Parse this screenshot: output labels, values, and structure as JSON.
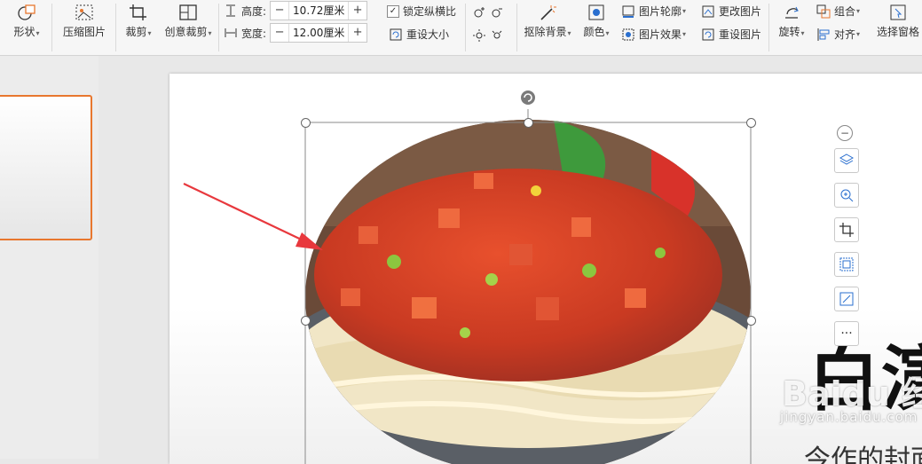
{
  "ribbon": {
    "shape_label": "形状",
    "compress_label": "压缩图片",
    "crop_label": "裁剪",
    "creative_crop_label": "创意裁剪",
    "height_label": "高度:",
    "height_value": "10.72厘米",
    "width_label": "宽度:",
    "width_value": "12.00厘米",
    "lock_ratio_label": "锁定纵横比",
    "reset_size_label": "重设大小",
    "remove_bg_label": "抠除背景",
    "color_label": "颜色",
    "outline_label": "图片轮廓",
    "effects_label": "图片效果",
    "change_picture_label": "更改图片",
    "reset_picture_label": "重设图片",
    "rotate_label": "旋转",
    "group_label": "组合",
    "align_label": "对齐",
    "selection_pane_label": "选择窗格"
  },
  "slide": {
    "big_text": "白演示",
    "sub_text": "…今作的封面引",
    "watermark_main": "Baidu 经验",
    "watermark_url": "jingyan.baidu.com"
  },
  "colors": {
    "accent_orange": "#e8772e",
    "annotation_red": "#e8383d",
    "icon_blue": "#2a6fcf"
  }
}
